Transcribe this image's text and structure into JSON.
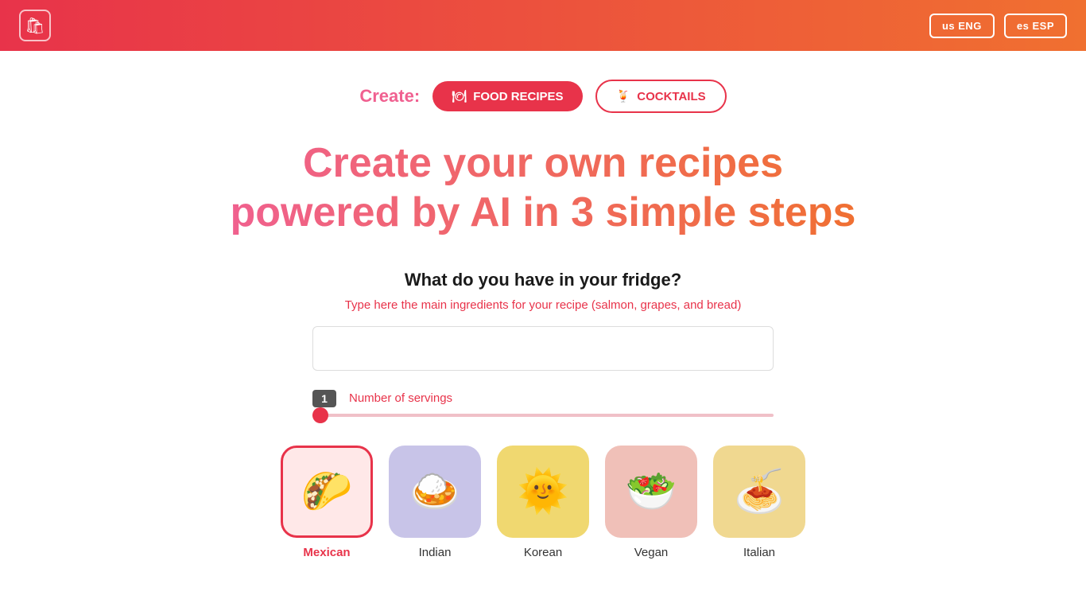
{
  "header": {
    "logo_icon": "🛍",
    "lang_eng_label": "us ENG",
    "lang_esp_label": "es ESP"
  },
  "create_bar": {
    "label": "Create:",
    "tab_food_label": "FOOD RECIPES",
    "tab_food_icon": "🍽",
    "tab_cocktails_label": "COCKTAILS",
    "tab_cocktails_icon": "🍹"
  },
  "hero": {
    "title": "Create your own recipes powered by AI in 3 simple steps"
  },
  "form": {
    "question": "What do you have in your fridge?",
    "subtitle_plain": "Type here the main ingredients for your recipe (",
    "subtitle_highlight": "salmon, grapes, and bread",
    "subtitle_end": ")",
    "input_placeholder": "",
    "slider_value": "1",
    "slider_label": "Number of servings"
  },
  "cuisines": [
    {
      "id": "mexican",
      "name": "Mexican",
      "emoji": "🌮",
      "color_class": "mexican",
      "selected": true
    },
    {
      "id": "indian",
      "name": "Indian",
      "emoji": "🍛",
      "color_class": "indian",
      "selected": false
    },
    {
      "id": "korean",
      "name": "Korean",
      "emoji": "🌞",
      "color_class": "korean",
      "selected": false
    },
    {
      "id": "vegan",
      "name": "Vegan",
      "emoji": "🥗",
      "color_class": "vegan",
      "selected": false
    },
    {
      "id": "italian",
      "name": "Italian",
      "emoji": "🍝",
      "color_class": "italian",
      "selected": false
    }
  ]
}
